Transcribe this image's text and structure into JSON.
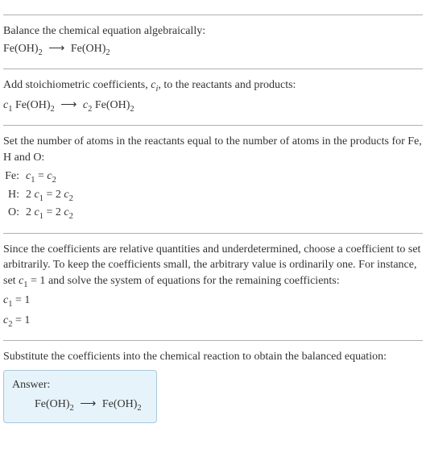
{
  "s1": {
    "prompt": "Balance the chemical equation algebraically:",
    "eq_lhs": "Fe(OH)",
    "eq_lhs_sub": "2",
    "arrow": "⟶",
    "eq_rhs": "Fe(OH)",
    "eq_rhs_sub": "2"
  },
  "s2": {
    "prompt_a": "Add stoichiometric coefficients, ",
    "ci": "c",
    "ci_sub": "i",
    "prompt_b": ", to the reactants and products:",
    "c1": "c",
    "c1_sub": "1",
    "sp1": " Fe(OH)",
    "sp1_sub": "2",
    "arrow": "⟶",
    "c2": "c",
    "c2_sub": "2",
    "sp2": " Fe(OH)",
    "sp2_sub": "2"
  },
  "s3": {
    "prompt": "Set the number of atoms in the reactants equal to the number of atoms in the products for Fe, H and O:",
    "rows": [
      {
        "el": "Fe:",
        "lhs_coef": "",
        "lhs_c": "c",
        "lhs_sub": "1",
        "eq": " = ",
        "rhs_coef": "",
        "rhs_c": "c",
        "rhs_sub": "2"
      },
      {
        "el": "H:",
        "lhs_coef": "2 ",
        "lhs_c": "c",
        "lhs_sub": "1",
        "eq": " = ",
        "rhs_coef": "2 ",
        "rhs_c": "c",
        "rhs_sub": "2"
      },
      {
        "el": "O:",
        "lhs_coef": "2 ",
        "lhs_c": "c",
        "lhs_sub": "1",
        "eq": " = ",
        "rhs_coef": "2 ",
        "rhs_c": "c",
        "rhs_sub": "2"
      }
    ]
  },
  "s4": {
    "prompt_a": "Since the coefficients are relative quantities and underdetermined, choose a coefficient to set arbitrarily. To keep the coefficients small, the arbitrary value is ordinarily one. For instance, set ",
    "cset": "c",
    "cset_sub": "1",
    "cset_val": " = 1",
    "prompt_b": " and solve the system of equations for the remaining coefficients:",
    "res": [
      {
        "c": "c",
        "sub": "1",
        "val": " = 1"
      },
      {
        "c": "c",
        "sub": "2",
        "val": " = 1"
      }
    ]
  },
  "s5": {
    "prompt": "Substitute the coefficients into the chemical reaction to obtain the balanced equation:",
    "ans_label": "Answer:",
    "eq_lhs": "Fe(OH)",
    "eq_lhs_sub": "2",
    "arrow": "⟶",
    "eq_rhs": "Fe(OH)",
    "eq_rhs_sub": "2"
  }
}
